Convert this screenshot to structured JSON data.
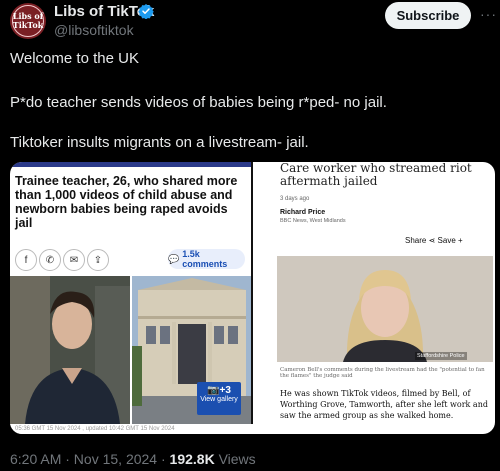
{
  "account": {
    "name": "Libs of TikTok",
    "handle": "@libsoftiktok",
    "avatar_line1": "Libs of",
    "avatar_line2": "TikTok"
  },
  "subscribe_label": "Subscribe",
  "more_label": "···",
  "tweet_lines": [
    "Welcome to the UK",
    "P*do teacher sends videos of babies being r*ped- no jail.",
    "Tiktoker insults migrants on a livestream- jail."
  ],
  "left_article": {
    "headline": "Trainee teacher, 26, who shared more than 1,000 videos of child abuse and newborn babies being raped avoids jail",
    "comments_label": "1.5k comments",
    "gallery_count": "+3",
    "gallery_label": "View gallery",
    "footer_text": "05:36 GMT 15 Nov 2024 , updated 10:42 GMT 15 Nov 2024"
  },
  "right_article": {
    "headline": "Care worker who streamed riot aftermath jailed",
    "date": "3 days ago",
    "author": "Richard Price",
    "location": "BBC News, West Midlands",
    "share_label": "Share",
    "save_label": "Save +",
    "photo_credit": "Staffordshire Police",
    "caption": "Cameron Bell's comments during the livestream had the \"potential to fan the flames\" the judge said",
    "body": "He was shown TikTok videos, filmed by Bell, of Worthing Grove, Tamworth, after she left work and saw the armed group as she walked home."
  },
  "meta": {
    "time_date": "6:20 AM · Nov 15, 2024 · ",
    "views_count": "192.8K",
    "views_label": " Views"
  },
  "colors": {
    "background": "#000000",
    "text": "#e7e9ea",
    "muted": "#71767b",
    "verified": "#1d9bf0",
    "subscribe_bg": "#eff3f4"
  }
}
